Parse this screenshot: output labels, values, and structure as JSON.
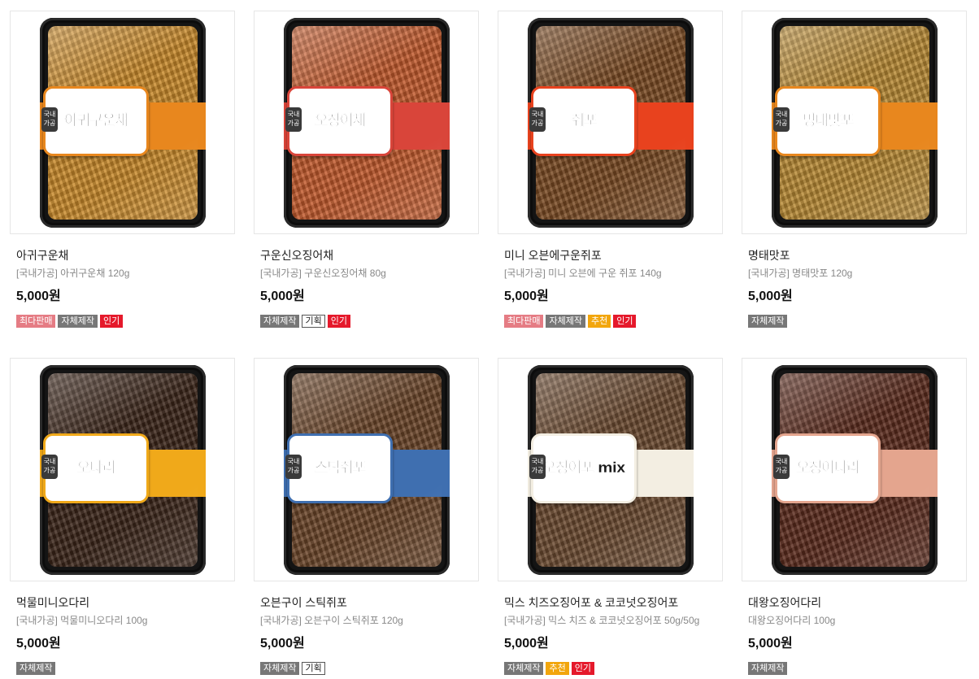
{
  "colors": {
    "tag_best": "#e57c84",
    "tag_own": "#777777",
    "tag_hot": "#e5192b",
    "tag_rec": "#f2a60d",
    "tag_plan_border": "#555555"
  },
  "products": [
    {
      "name": "아귀구운채",
      "desc": "[국내가공] 아귀구운채 120g",
      "price": "5,000원",
      "image": {
        "label": "아귀구운채",
        "mark": "국내가공",
        "band_color": "#e8871e",
        "food_color": "#c98a2a"
      },
      "tags": [
        {
          "label": "최다판매",
          "type": "best"
        },
        {
          "label": "자체제작",
          "type": "own"
        },
        {
          "label": "인기",
          "type": "hot"
        }
      ]
    },
    {
      "name": "구운신오징어채",
      "desc": "[국내가공] 구운신오징어채 80g",
      "price": "5,000원",
      "image": {
        "label": "오징어채",
        "mark": "국내가공",
        "band_color": "#d9453a",
        "food_color": "#c25a2c"
      },
      "tags": [
        {
          "label": "자체제작",
          "type": "own"
        },
        {
          "label": "기획",
          "type": "plan"
        },
        {
          "label": "인기",
          "type": "hot"
        }
      ]
    },
    {
      "name": "미니 오븐에구운쥐포",
      "desc": "[국내가공] 미니 오븐에 구운 쥐포 140g",
      "price": "5,000원",
      "image": {
        "label": "쥐포",
        "mark": "국내가공",
        "band_color": "#e8421e",
        "food_color": "#7a4a22"
      },
      "tags": [
        {
          "label": "최다판매",
          "type": "best"
        },
        {
          "label": "자체제작",
          "type": "own"
        },
        {
          "label": "추천",
          "type": "rec"
        },
        {
          "label": "인기",
          "type": "hot"
        }
      ]
    },
    {
      "name": "명태맛포",
      "desc": "[국내가공] 명태맛포 120g",
      "price": "5,000원",
      "image": {
        "label": "명태맛포",
        "mark": "국내가공",
        "band_color": "#e8871e",
        "food_color": "#b88a34"
      },
      "tags": [
        {
          "label": "자체제작",
          "type": "own"
        }
      ]
    },
    {
      "name": "먹물미니오다리",
      "desc": "[국내가공] 먹물미니오다리 100g",
      "price": "5,000원",
      "image": {
        "label": "오다리",
        "mark": "국내가공",
        "band_color": "#f0a91a",
        "food_color": "#3a2418"
      },
      "tags": [
        {
          "label": "자체제작",
          "type": "own"
        }
      ]
    },
    {
      "name": "오븐구이 스틱쥐포",
      "desc": "[국내가공] 오븐구이 스틱쥐포 120g",
      "price": "5,000원",
      "image": {
        "label": "스틱쥐포",
        "mark": "국내가공",
        "band_color": "#3f6fb0",
        "food_color": "#6a4428"
      },
      "tags": [
        {
          "label": "자체제작",
          "type": "own"
        },
        {
          "label": "기획",
          "type": "plan"
        }
      ]
    },
    {
      "name": "믹스 치즈오징어포 & 코코넛오징어포",
      "desc": "[국내가공] 믹스 치즈 & 코코넛오징어포 50g/50g",
      "price": "5,000원",
      "image": {
        "label": "오징어포 mix",
        "mark": "국내가공",
        "band_color": "#f3eee2",
        "food_color": "#6b4a30"
      },
      "tags": [
        {
          "label": "자체제작",
          "type": "own"
        },
        {
          "label": "추천",
          "type": "rec"
        },
        {
          "label": "인기",
          "type": "hot"
        }
      ]
    },
    {
      "name": "대왕오징어다리",
      "desc": "대왕오징어다리 100g",
      "price": "5,000원",
      "image": {
        "label": "오징어다리",
        "mark": "국내가공",
        "band_color": "#e4a58e",
        "food_color": "#5a2a1c"
      },
      "tags": [
        {
          "label": "자체제작",
          "type": "own"
        }
      ]
    }
  ]
}
